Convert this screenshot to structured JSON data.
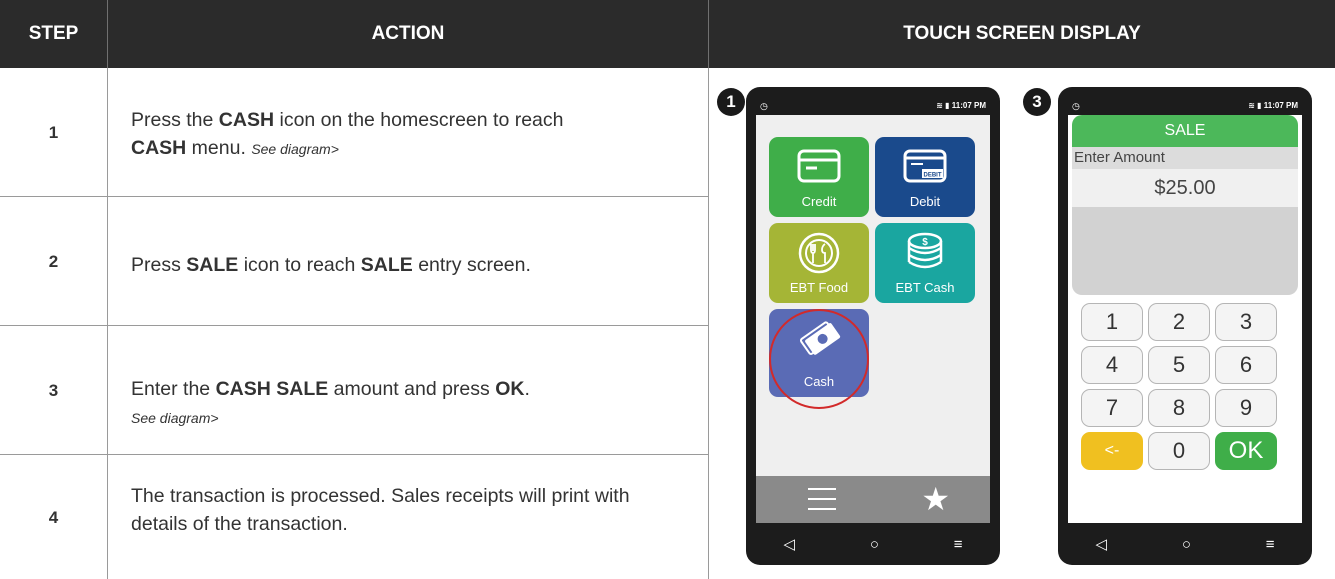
{
  "header": {
    "step": "STEP",
    "action": "ACTION",
    "touch": "TOUCH SCREEN DISPLAY"
  },
  "rows": [
    {
      "step": "1",
      "parts": [
        "Press the ",
        "CASH",
        " icon on the homescreen to reach ",
        "CASH",
        " menu. ",
        "See diagram>"
      ]
    },
    {
      "step": "2",
      "parts": [
        "Press ",
        "SALE",
        " icon to reach ",
        "SALE",
        " entry screen."
      ]
    },
    {
      "step": "3",
      "parts": [
        "Enter the ",
        "CASH SALE",
        " amount and press ",
        "OK",
        ".",
        "See diagram>"
      ]
    },
    {
      "step": "4",
      "parts": [
        "The transaction is processed. Sales receipts will print with details of the transaction."
      ]
    }
  ],
  "phone1": {
    "badge": "1",
    "time": "11:07 PM",
    "tiles": {
      "credit": "Credit",
      "debit": "Debit",
      "debit_card_text": "DEBIT",
      "ebt_food": "EBT Food",
      "ebt_cash": "EBT Cash",
      "cash": "Cash"
    }
  },
  "phone3": {
    "badge": "3",
    "time": "11:07 PM",
    "title": "SALE",
    "prompt": "Enter Amount",
    "amount": "$25.00",
    "keys": [
      "1",
      "2",
      "3",
      "4",
      "5",
      "6",
      "7",
      "8",
      "9",
      "<-",
      "0",
      "OK"
    ]
  },
  "colors": {
    "credit": "#3fae49",
    "debit": "#1a4a8c",
    "ebt_food": "#a5b536",
    "ebt_cash": "#1aa6a0",
    "cash": "#5a6bb5",
    "sale_header": "#4cb85a",
    "backspace": "#f0c020",
    "ok": "#3fae49",
    "highlight": "#d22a2a"
  },
  "icons": [
    "card-icon",
    "debit-card-icon",
    "fork-spoon-icon",
    "coins-icon",
    "cash-bills-icon",
    "menu-icon",
    "star-icon",
    "back-icon",
    "home-icon",
    "recents-icon",
    "wifi-icon",
    "battery-icon",
    "clock-icon"
  ]
}
